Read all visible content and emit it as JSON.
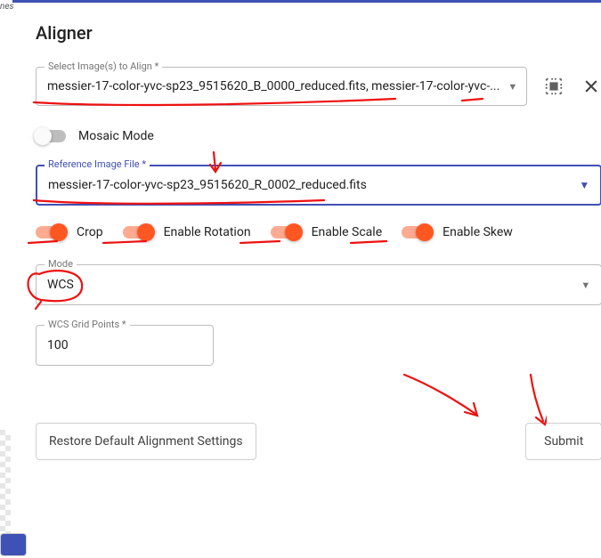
{
  "title": "Aligner",
  "select_images": {
    "label": "Select Image(s) to Align",
    "value": "messier-17-color-yvc-sp23_9515620_B_0000_reduced.fits, messier-17-color-yvc-..."
  },
  "mosaic": {
    "label": "Mosaic Mode",
    "on": false
  },
  "reference": {
    "label": "Reference Image File",
    "value": "messier-17-color-yvc-sp23_9515620_R_0002_reduced.fits"
  },
  "toggles": {
    "crop": "Crop",
    "rotation": "Enable Rotation",
    "scale": "Enable Scale",
    "skew": "Enable Skew"
  },
  "mode": {
    "label": "Mode",
    "value": "WCS"
  },
  "grid": {
    "label": "WCS Grid Points",
    "value": "100"
  },
  "buttons": {
    "restore": "Restore Default Alignment Settings",
    "submit": "Submit"
  },
  "annotations_color": "#e11",
  "left_text": "nes"
}
